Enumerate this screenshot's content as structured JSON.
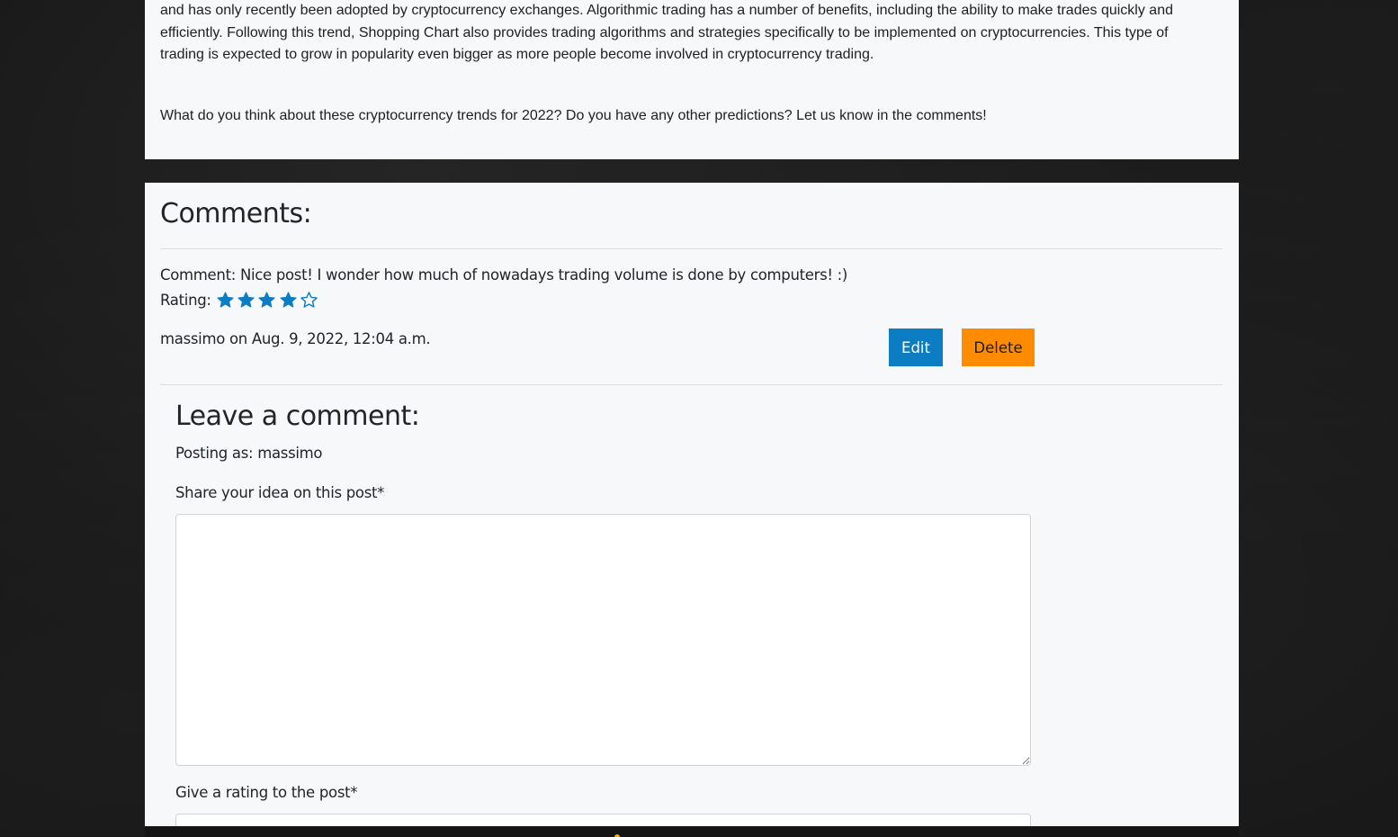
{
  "post": {
    "paragraph_1": "and has only recently been adopted by cryptocurrency exchanges. Algorithmic trading has a number of benefits, including the ability to make trades quickly and efficiently. Following this trend, Shopping Chart also provides trading algorithms and strategies specifically to be implemented on cryptocurrencies. This type of trading is expected to grow in popularity even bigger as more people become involved in cryptocurrency trading.",
    "paragraph_2": "What do you think about these cryptocurrency trends for 2022? Do you have any other predictions? Let us know in the comments!"
  },
  "comments": {
    "heading": "Comments:",
    "items": [
      {
        "comment_line": "Comment: Nice post! I wonder how much of nowadays trading volume is done by computers! :)",
        "rating_label": "Rating:",
        "rating_value": 4,
        "rating_max": 5,
        "meta": "massimo on Aug. 9, 2022, 12:04 a.m.",
        "edit_label": "Edit",
        "delete_label": "Delete"
      }
    ]
  },
  "leave_comment": {
    "heading": "Leave a comment:",
    "posting_as": "Posting as: massimo",
    "share_label": "Share your idea on this post*",
    "textarea_value": "",
    "rating_label": "Give a rating to the post*"
  },
  "colors": {
    "star_blue": "#0d7dc3",
    "edit_button_bg": "#0d7dc3",
    "delete_button_bg": "#ff8c00"
  },
  "icons": {
    "rating_filled": "star-filled-icon",
    "rating_empty": "star-outline-icon"
  }
}
